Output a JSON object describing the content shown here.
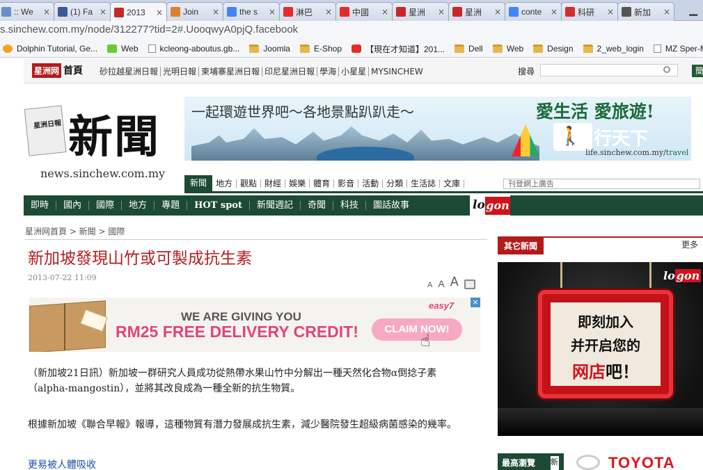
{
  "browser": {
    "tabs": [
      {
        "label": ":: We",
        "icon": "page-icon",
        "color": "#6b8fc7"
      },
      {
        "label": "(1) Fa",
        "icon": "facebook-icon",
        "color": "#3b5998"
      },
      {
        "label": "2013",
        "icon": "sinchew-icon",
        "color": "#c62828"
      },
      {
        "label": "Join",
        "icon": "puzzle-icon",
        "color": "#d9822b"
      },
      {
        "label": "the s",
        "icon": "google-icon",
        "color": "#4285f4"
      },
      {
        "label": "淋巴",
        "icon": "youtube-icon",
        "color": "#e52d27"
      },
      {
        "label": "中國",
        "icon": "youtube-icon",
        "color": "#e52d27"
      },
      {
        "label": "星洲",
        "icon": "sinchew-icon",
        "color": "#c62828"
      },
      {
        "label": "星洲",
        "icon": "sinchew-icon",
        "color": "#c62828"
      },
      {
        "label": "conte",
        "icon": "google-icon",
        "color": "#4285f4"
      },
      {
        "label": "科研",
        "icon": "science-icon",
        "color": "#d32f2f"
      },
      {
        "label": "新加",
        "icon": "news-icon",
        "color": "#555555"
      }
    ],
    "active_tab": 2,
    "url": "s.sinchew.com.my/node/312277?tid=2#.UooqwyA0pjQ.facebook",
    "bookmarks": [
      {
        "label": "Dolphin Tutorial, Ge...",
        "icon": "dolphin-icon"
      },
      {
        "label": "Web",
        "icon": "web-icon"
      },
      {
        "label": "kcleong-aboutus.gb...",
        "icon": "page-icon"
      },
      {
        "label": "Joomla",
        "icon": "folder-icon"
      },
      {
        "label": "E-Shop",
        "icon": "folder-icon"
      },
      {
        "label": "【現在才知道】201...",
        "icon": "youtube-icon"
      },
      {
        "label": "Dell",
        "icon": "folder-icon"
      },
      {
        "label": "Web",
        "icon": "folder-icon"
      },
      {
        "label": "Design",
        "icon": "folder-icon"
      },
      {
        "label": "2_web_login",
        "icon": "folder-icon"
      },
      {
        "label": "MZ Sper-M",
        "icon": "page-icon"
      }
    ]
  },
  "site": {
    "logo_mark": "星洲网",
    "logo_home": "首頁",
    "links": [
      "砂拉越星洲日報",
      "光明日報",
      "柬埔寨星洲日報",
      "印尼星洲日報",
      "學海",
      "小星星",
      "MYSINCHEW"
    ],
    "search_label": "搜尋",
    "simplified_button": "簡体",
    "section_logo": "新聞",
    "section_paper_mark": "星洲日報",
    "section_domain": "news.sinchew.com.my",
    "banner": {
      "slogan": "一起環遊世界吧～各地景點趴趴走～",
      "love": "愛生活 愛旅遊!",
      "brand": "行天下",
      "link_prefix": "life.sinchew.com.my/",
      "link_suffix": "travel"
    },
    "nav1": [
      "新聞",
      "地方",
      "觀點",
      "財經",
      "娛樂",
      "體育",
      "影音",
      "活動",
      "分類",
      "生活誌",
      "文庫"
    ],
    "nav1_active": 0,
    "ad_input_placeholder": "刊登網上廣告",
    "nav2": [
      "即時",
      "國內",
      "國際",
      "地方",
      "專題",
      "HOT spot",
      "新聞週記",
      "奇聞",
      "科技",
      "圖話故事"
    ],
    "logon": {
      "lo": "lo",
      "gon": "gon"
    }
  },
  "article": {
    "breadcrumb": "星洲网首頁 > 新聞 > 國際",
    "title": "新加坡發現山竹或可製成抗生素",
    "date": "2013-07-22 11:09",
    "font_sizes": [
      "A",
      "A",
      "A"
    ],
    "ad": {
      "line1": "WE ARE GIVING YOU",
      "line2": "RM25 FREE DELIVERY CREDIT!",
      "cta": "CLAIM NOW!",
      "logo": "easy7",
      "close": "×"
    },
    "paragraph1": "（新加坡21日訊）新加坡一群研究人員成功從熱帶水果山竹中分解出一種天然化合物α倒捻子素（alpha-mangostin），並將其改良成為一種全新的抗生物質。",
    "paragraph2": "根據新加坡《聯合早報》報導，這種物質有潛力發展成抗生素，減少醫院發生超級病菌感染的幾率。",
    "sublink": "更易被人體吸收"
  },
  "sidebar": {
    "other_news_title": "其它新聞",
    "more": "更多",
    "ad": {
      "logon": {
        "lo": "lo",
        "gon": "gon"
      },
      "line1": "即刻加入",
      "line2": "并开启您的",
      "line3_red": "网店",
      "line3_rest": "吧！"
    },
    "latest_title": "最高瀏覽",
    "latest_tab": "新",
    "toyota": "TOYOTA"
  }
}
